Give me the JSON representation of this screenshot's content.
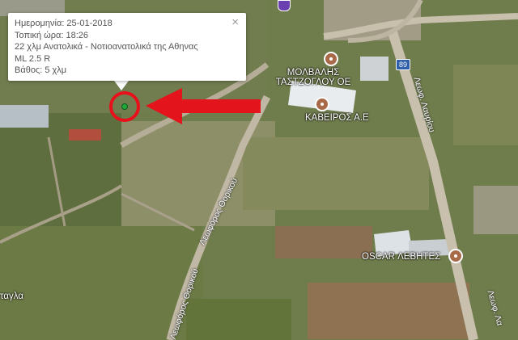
{
  "popup": {
    "date": "Ημερομηνία: 25-01-2018",
    "local_time": "Τοπική ώρα: 18:26",
    "location": "22 χλμ Ανατολικά - Νοτιοανατολικά της Αθηνας",
    "magnitude": "ML 2.5 R",
    "depth": "Βάθος: 5 χλμ",
    "close": "×"
  },
  "places": {
    "molvalis": "ΜΟΛΒΑΛΗΣ ΤΑΣΤΖΟΓΛΟΥ ΟΕ",
    "kaveiros": "ΚΑΒΕΙΡΟΣ Α.Ε",
    "oscar": "OSCAR ΛΕΒΗΤΕΣ",
    "tagla": "ταγλα"
  },
  "roads": {
    "thorikou_upper": "Λεωφόρος Θορικού",
    "thorikou_lower": "Λεωφόρος Θορικού",
    "lavriou_upper": "Λεωφ. Λαυρίου",
    "lavriou_lower": "Λεωφ. Λα"
  },
  "route_shield": "89",
  "colors": {
    "marker_ring": "#e8101a",
    "marker_dot": "#1faa3a",
    "arrow": "#e3141b",
    "poi": "#a86a48",
    "shield": "#2f5fa8"
  }
}
